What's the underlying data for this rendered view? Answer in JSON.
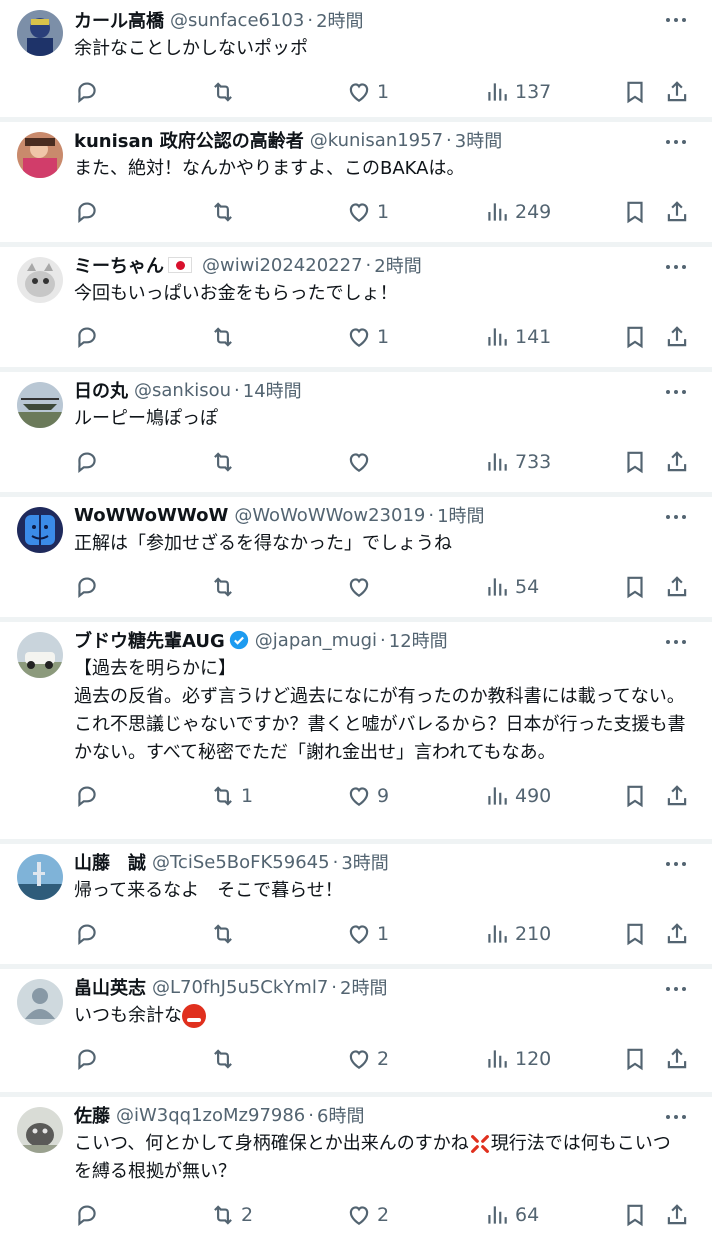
{
  "tweets": [
    {
      "name": "カール高橋",
      "handle": "@sunface6103",
      "time": "2時間",
      "text": "余計なことしかしないポッポ",
      "replies": "",
      "retweets": "",
      "likes": "1",
      "views": "137"
    },
    {
      "name": "kunisan 政府公認の高齢者",
      "handle": "@kunisan1957",
      "time": "3時間",
      "text": "また、絶対！なんかやりますよ、このBAKAは。",
      "replies": "",
      "retweets": "",
      "likes": "1",
      "views": "249"
    },
    {
      "name": "ミーちゃん",
      "handle": "@wiwi202420227",
      "time": "2時間",
      "text": "今回もいっぱいお金をもらったでしょ！",
      "replies": "",
      "retweets": "",
      "likes": "1",
      "views": "141"
    },
    {
      "name": "日の丸",
      "handle": "@sankisou",
      "time": "14時間",
      "text": "ルーピー鳩ぽっぽ",
      "replies": "",
      "retweets": "",
      "likes": "",
      "views": "733"
    },
    {
      "name": "WoWWoWWoW",
      "handle": "@WoWoWWow23019",
      "time": "1時間",
      "text": "正解は「参加せざるを得なかった」でしょうね",
      "replies": "",
      "retweets": "",
      "likes": "",
      "views": "54"
    },
    {
      "name": "ブドウ糖先輩AUG",
      "handle": "@japan_mugi",
      "time": "12時間",
      "text": "【過去を明らかに】\n過去の反省。必ず言うけど過去になにが有ったのか教科書には載ってない。これ不思議じゃないですか？書くと嘘がバレるから？日本が行った支援も書かない。すべて秘密でただ「謝れ金出せ」言われてもなあ。",
      "replies": "",
      "retweets": "1",
      "likes": "9",
      "views": "490"
    },
    {
      "name": "山藤　誠",
      "handle": "@TciSe5BoFK59645",
      "time": "3時間",
      "text": "帰って来るなよ　そこで暮らせ！",
      "replies": "",
      "retweets": "",
      "likes": "1",
      "views": "210"
    },
    {
      "name": "畠山英志",
      "handle": "@L70fhJ5u5CkYml7",
      "time": "2時間",
      "text": "いつも余計な",
      "replies": "",
      "retweets": "",
      "likes": "2",
      "views": "120"
    },
    {
      "name": "佐藤",
      "handle": "@iW3qq1zoMz97986",
      "time": "6時間",
      "text_a": "こいつ、何とかして身柄確保とか出来んのすかね",
      "text_b": "現行法では何もこいつを縛る根拠が無い？",
      "replies": "",
      "retweets": "2",
      "likes": "2",
      "views": "64"
    }
  ],
  "colors": {
    "text": "#0f1419",
    "muted": "#536471",
    "divider": "#eff3f4",
    "verified": "#1d9bf0"
  },
  "icons": [
    "reply-icon",
    "retweet-icon",
    "like-icon",
    "views-icon",
    "bookmark-icon",
    "share-icon",
    "more-icon"
  ]
}
